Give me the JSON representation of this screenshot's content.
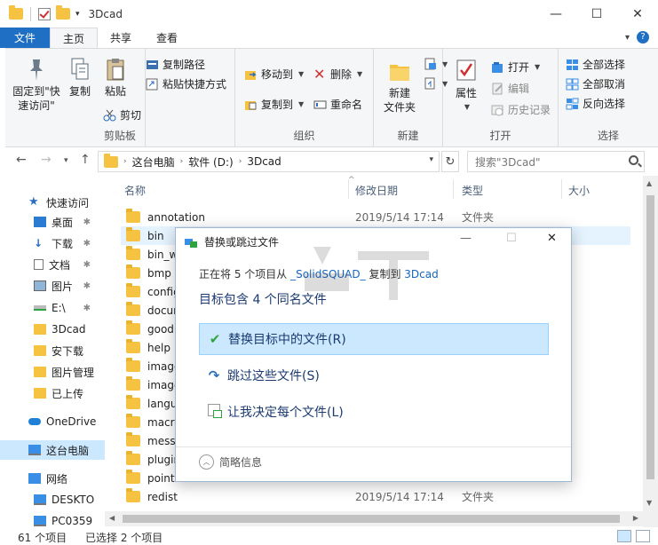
{
  "window": {
    "title": "3Dcad",
    "minimize": "—",
    "maximize": "☐",
    "close": "✕"
  },
  "tabs": {
    "file": "文件",
    "home": "主页",
    "share": "共享",
    "view": "查看",
    "help": "?"
  },
  "ribbon": {
    "clipboard": {
      "label": "剪贴板",
      "pin": "固定到\"快速访问\"",
      "copy": "复制",
      "paste": "粘贴",
      "copy_path": "复制路径",
      "paste_shortcut": "粘贴快捷方式",
      "cut": "剪切"
    },
    "organize": {
      "label": "组织",
      "move_to": "移动到",
      "copy_to": "复制到",
      "delete": "删除",
      "rename": "重命名"
    },
    "new": {
      "label": "新建",
      "new_folder": "新建\n文件夹"
    },
    "open": {
      "label": "打开",
      "properties": "属性",
      "open": "打开",
      "edit": "编辑",
      "history": "历史记录"
    },
    "select": {
      "label": "选择",
      "select_all": "全部选择",
      "select_none": "全部取消",
      "invert": "反向选择"
    }
  },
  "address": {
    "crumbs": [
      "这台电脑",
      "软件 (D:)",
      "3Dcad"
    ],
    "search_placeholder": "搜索\"3Dcad\""
  },
  "nav": {
    "items": [
      {
        "label": "快速访问",
        "icon": "star-icon"
      },
      {
        "label": "桌面",
        "icon": "desktop-icon",
        "pinned": true
      },
      {
        "label": "下载",
        "icon": "download-icon",
        "pinned": true
      },
      {
        "label": "文档",
        "icon": "document-icon",
        "pinned": true
      },
      {
        "label": "图片",
        "icon": "picture-icon",
        "pinned": true
      },
      {
        "label": "E:\\",
        "icon": "drive-icon",
        "pinned": true
      },
      {
        "label": "3Dcad",
        "icon": "folder-icon"
      },
      {
        "label": "安下载",
        "icon": "folder-icon"
      },
      {
        "label": "图片管理",
        "icon": "folder-icon"
      },
      {
        "label": "已上传",
        "icon": "folder-icon"
      },
      {
        "label": "OneDrive",
        "icon": "cloud-icon"
      },
      {
        "label": "这台电脑",
        "icon": "computer-icon"
      },
      {
        "label": "网络",
        "icon": "network-icon"
      },
      {
        "label": "DESKTO",
        "icon": "computer-icon"
      },
      {
        "label": "PC0359",
        "icon": "computer-icon"
      }
    ]
  },
  "columns": {
    "name": "名称",
    "date": "修改日期",
    "type": "类型",
    "size": "大小"
  },
  "files": [
    {
      "name": "annotation",
      "date": "2019/5/14 17:14",
      "type": "文件夹"
    },
    {
      "name": "bin",
      "date": "",
      "type": ""
    },
    {
      "name": "bin_wi",
      "date": "",
      "type": ""
    },
    {
      "name": "bmp",
      "date": "",
      "type": ""
    },
    {
      "name": "config",
      "date": "",
      "type": ""
    },
    {
      "name": "docum",
      "date": "",
      "type": ""
    },
    {
      "name": "goodi",
      "date": "",
      "type": ""
    },
    {
      "name": "help",
      "date": "",
      "type": ""
    },
    {
      "name": "image",
      "date": "",
      "type": ""
    },
    {
      "name": "image",
      "date": "",
      "type": ""
    },
    {
      "name": "langua",
      "date": "",
      "type": ""
    },
    {
      "name": "macro",
      "date": "",
      "type": ""
    },
    {
      "name": "messa",
      "date": "",
      "type": ""
    },
    {
      "name": "plugin",
      "date": "",
      "type": ""
    },
    {
      "name": "pointo",
      "date": "",
      "type": ""
    },
    {
      "name": "redist",
      "date": "2019/5/14 17:14",
      "type": "文件夹"
    }
  ],
  "status": {
    "count": "61 个项目",
    "selected": "已选择 2 个项目"
  },
  "dialog": {
    "title": "替换或跳过文件",
    "line1_pre": "正在将 5 个项目从 ",
    "line1_src": "_SolidSQUAD_",
    "line1_mid": " 复制到 ",
    "line1_dst": "3Dcad",
    "line2": "目标包含 4 个同名文件",
    "opt_replace": "替换目标中的文件(R)",
    "opt_skip": "跳过这些文件(S)",
    "opt_decide": "让我决定每个文件(L)",
    "more": "简略信息"
  },
  "watermark": "安下载"
}
